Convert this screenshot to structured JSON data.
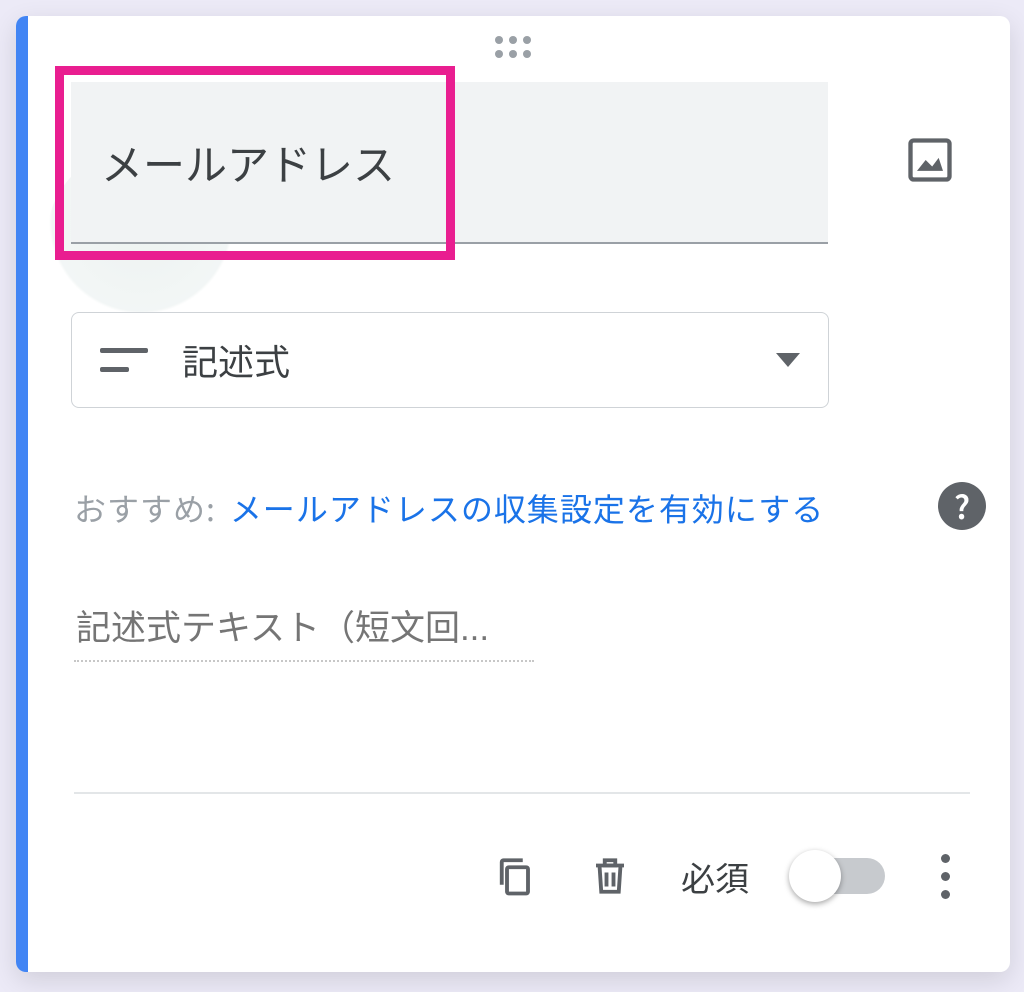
{
  "question": {
    "title": "メールアドレス",
    "type_label": "記述式",
    "short_answer_placeholder": "記述式テキスト（短文回..."
  },
  "suggestion": {
    "label": "おすすめ:",
    "link_text": "メールアドレスの収集設定を有効にする"
  },
  "footer": {
    "required_label": "必須",
    "required_on": false
  },
  "icons": {
    "image": "image-icon",
    "help": "?",
    "copy": "copy-icon",
    "delete": "trash-icon",
    "more": "more-vertical-icon",
    "caret": "caret-down-icon",
    "short_answer": "short-answer-icon",
    "drag": "drag-handle-icon"
  },
  "colors": {
    "accent": "#4285f4",
    "highlight": "#e91e90",
    "link": "#1a73e8"
  }
}
